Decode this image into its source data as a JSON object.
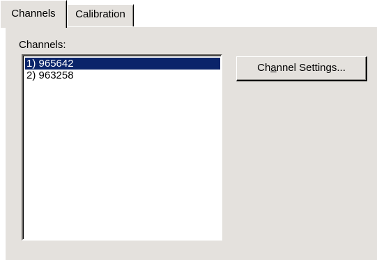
{
  "tabs": [
    {
      "label": "Channels",
      "selected": true
    },
    {
      "label": "Calibration",
      "selected": false
    }
  ],
  "channels_group": {
    "label": "Channels:",
    "items": [
      {
        "label": "1) 965642",
        "selected": true
      },
      {
        "label": "2) 963258",
        "selected": false
      }
    ]
  },
  "channel_settings_button": {
    "label_before": "Ch",
    "mnemonic": "a",
    "label_after": "nnel Settings..."
  },
  "colors": {
    "face": "#e4e1dd",
    "selection": "#0a246a",
    "selection_text": "#ffffff"
  }
}
